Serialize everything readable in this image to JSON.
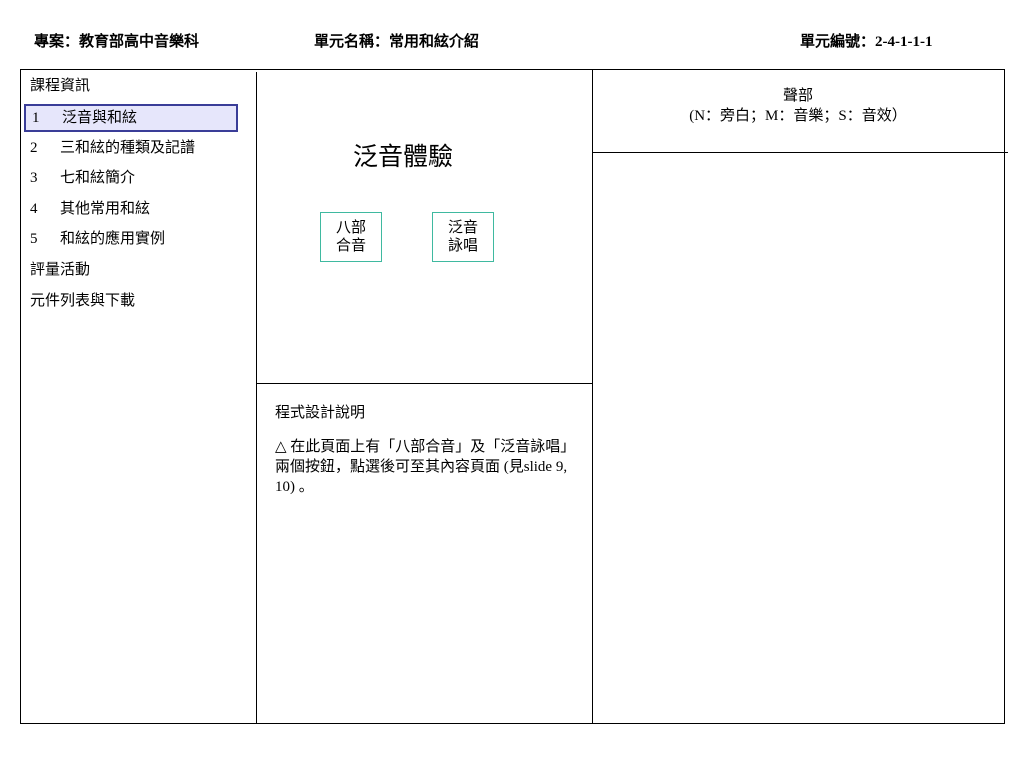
{
  "header": {
    "project": "專案：教育部高中音樂科",
    "unit_name": "單元名稱：常用和絃介紹",
    "unit_code": "單元編號：2-4-1-1-1"
  },
  "sidebar": {
    "heading": "課程資訊",
    "items": [
      {
        "num": "1",
        "label": "泛音與和絃",
        "selected": true
      },
      {
        "num": "2",
        "label": "三和絃的種類及記譜"
      },
      {
        "num": "3",
        "label": "七和絃簡介"
      },
      {
        "num": "4",
        "label": "其他常用和絃"
      },
      {
        "num": "5",
        "label": "和絃的應用實例"
      }
    ],
    "assessment": "評量活動",
    "components": "元件列表與下載"
  },
  "content": {
    "title": "泛音體驗",
    "buttons": [
      {
        "line1": "八部",
        "line2": "合音"
      },
      {
        "line1": "泛音",
        "line2": "詠唱"
      }
    ]
  },
  "notes": {
    "title": "程式設計說明",
    "body": "△  在此頁面上有「八部合音」及「泛音詠唱」兩個按鈕，點選後可至其內容頁面 (見slide 9, 10) 。"
  },
  "sound": {
    "title": "聲部",
    "legend": "(N：旁白；M：音樂；S：音效）"
  }
}
